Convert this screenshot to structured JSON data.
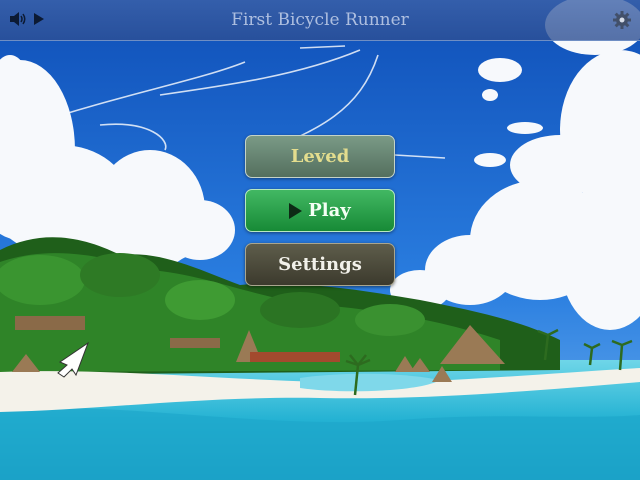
{
  "window": {
    "title": "First Bicycle Runner"
  },
  "toolbar": {
    "sound_icon": "speaker-icon",
    "play_icon": "play-icon",
    "settings_icon": "gear-icon"
  },
  "menu": {
    "level_label": "Leved",
    "play_label": "Play",
    "settings_label": "Settings"
  },
  "colors": {
    "sky": "#1a5fc4",
    "sea": "#29b6d6",
    "sand": "#f4f2ea",
    "jungle": "#2f7d26",
    "play_button": "#2da84c",
    "level_text": "#e3dd8e"
  }
}
